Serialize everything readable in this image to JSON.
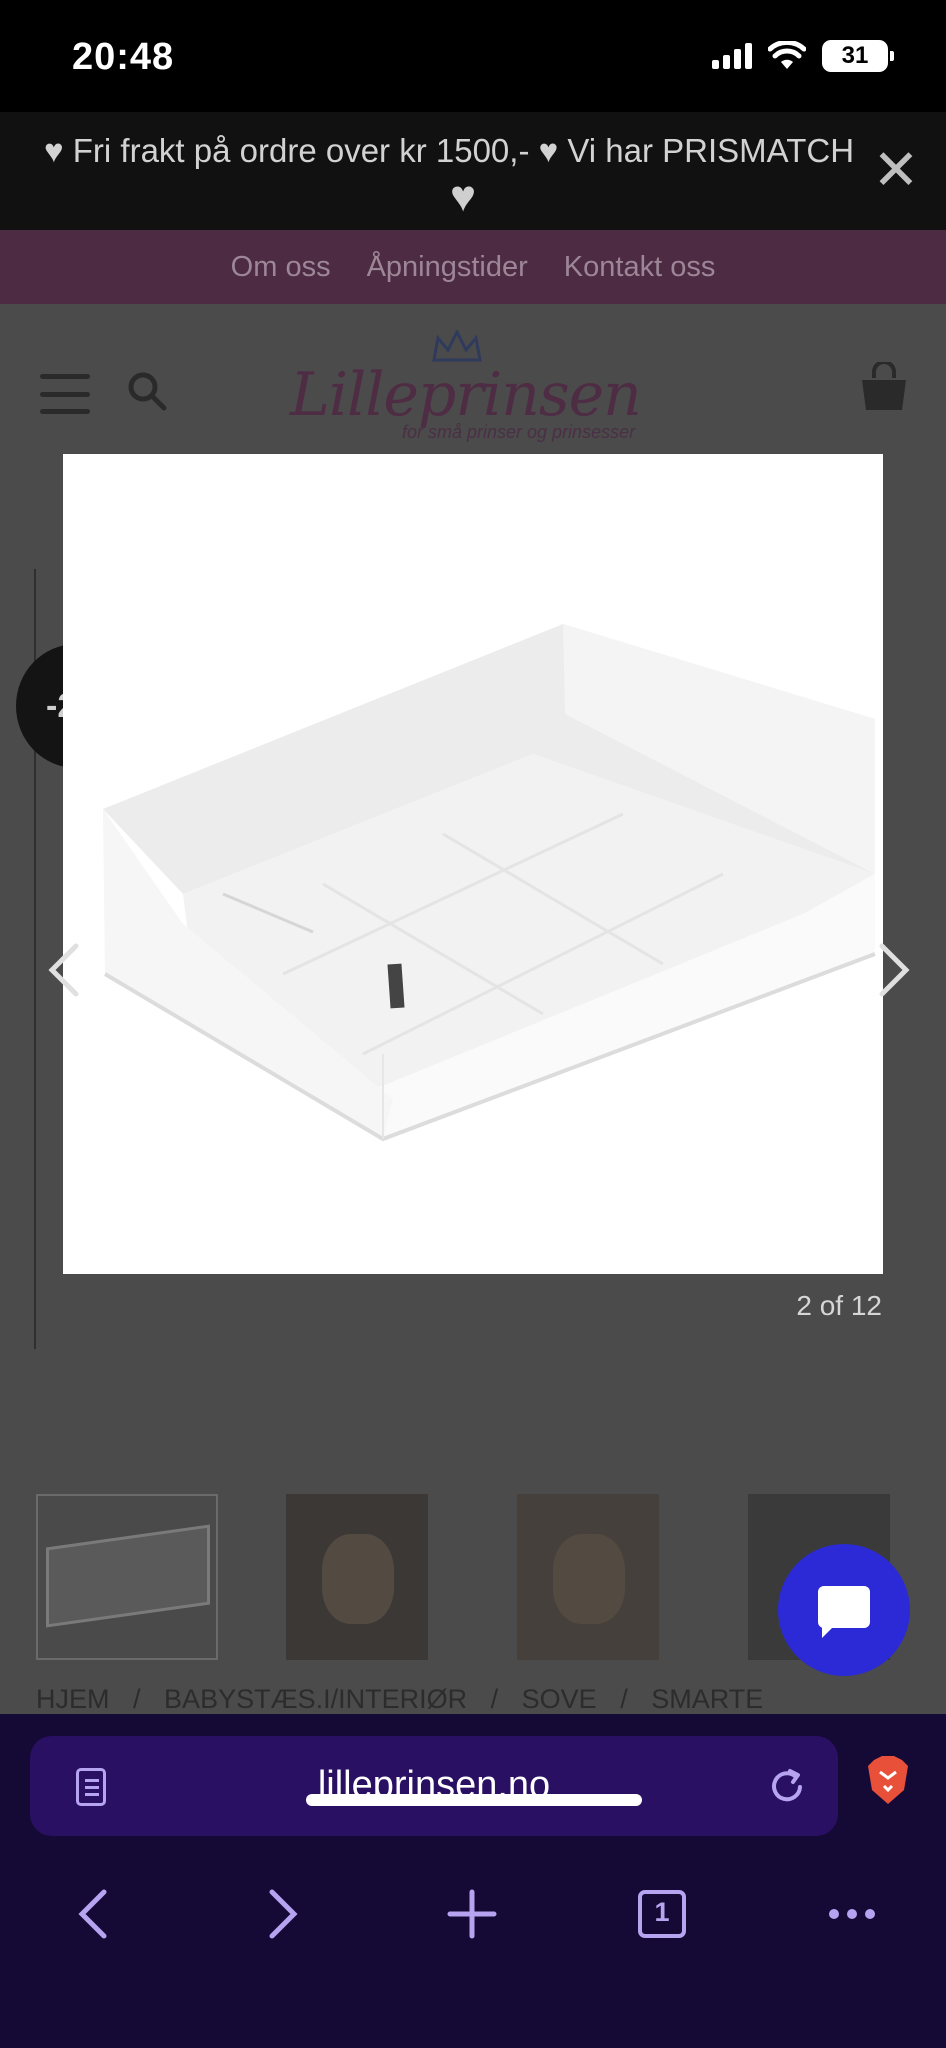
{
  "status": {
    "time": "20:48",
    "battery": "31"
  },
  "promo": {
    "text": "♥ Fri frakt på ordre over kr 1500,- ♥ Vi har PRISMATCH",
    "trailing_heart": "♥",
    "close_icon": "close-icon"
  },
  "topnav": {
    "items": [
      "Om oss",
      "Åpningstider",
      "Kontakt oss"
    ]
  },
  "header": {
    "logo_text": "Lilleprinsen",
    "logo_tagline": "for små prinser og prinsesser",
    "menu_icon": "hamburger-icon",
    "search_icon": "search-icon",
    "cart_icon": "cart-icon"
  },
  "product": {
    "discount_badge": "-2",
    "breadcrumbs": [
      "HJEM",
      "/",
      "BABYSTÆS.I/INTERIØR",
      "/",
      "SOVE",
      "/",
      "SMARTE"
    ]
  },
  "lightbox": {
    "counter": "2 of 12",
    "prev_icon": "chevron-left-icon",
    "next_icon": "chevron-right-icon"
  },
  "browser": {
    "url": "lilleprinsen.no",
    "tab_count": "1"
  },
  "colors": {
    "chat_bubble": "#2c2ad6",
    "browser_bar": "#150a36",
    "url_bar": "#2a1063",
    "topnav": "#4c2b43"
  }
}
